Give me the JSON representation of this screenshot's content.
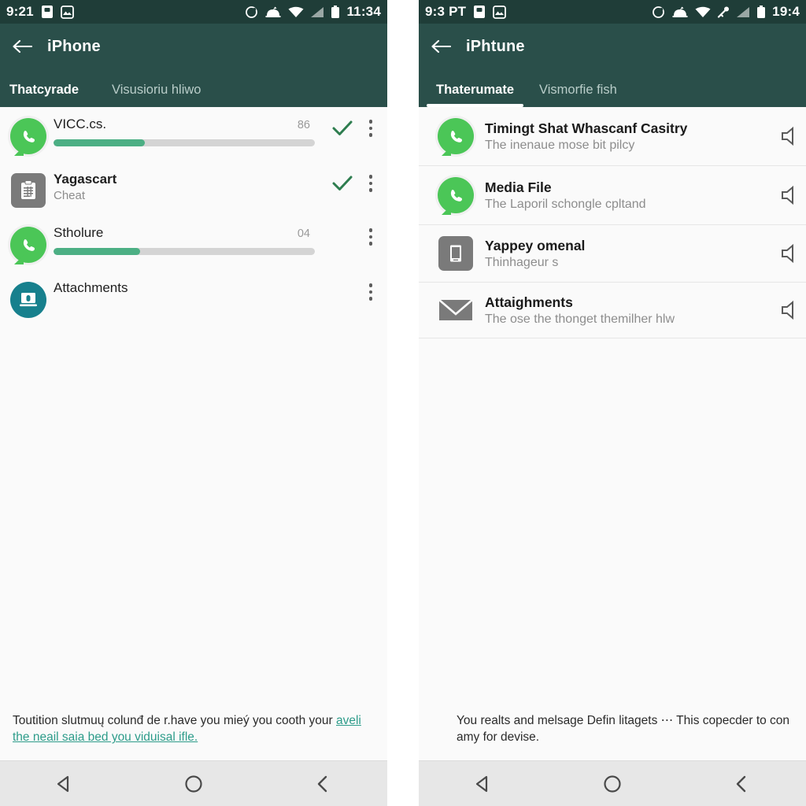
{
  "left": {
    "status_bar": {
      "clock_left": "9:21",
      "clock_right": "11:34",
      "icons_left": [
        "sim-card-icon",
        "photos-icon"
      ],
      "icons_right": [
        "sync-icon",
        "notification-icon",
        "wifi-icon",
        "signal-icon",
        "battery-icon"
      ]
    },
    "appbar": {
      "back": "back-arrow",
      "title": "iPhone"
    },
    "tabs": [
      {
        "label": "Thatcyrade",
        "active": true
      },
      {
        "label": "Visusioriu hliwo",
        "active": false
      }
    ],
    "rows": [
      {
        "icon": "whatsapp-icon",
        "title": "VICC.cs.",
        "subtitle": "",
        "value": "86",
        "progress": 35,
        "check": true,
        "menu": true,
        "bold": false
      },
      {
        "icon": "clipboard-icon",
        "title": "Yagascart",
        "subtitle": "Cheat",
        "value": "",
        "progress": -1,
        "check": true,
        "menu": true,
        "bold": true
      },
      {
        "icon": "whatsapp-icon",
        "title": "Stholure",
        "subtitle": "",
        "value": "04",
        "progress": 33,
        "check": false,
        "menu": true,
        "bold": false
      },
      {
        "icon": "laptop-lock-icon",
        "title": "Attachments",
        "subtitle": "",
        "value": "",
        "progress": -1,
        "check": false,
        "menu": true,
        "bold": false
      }
    ],
    "footnote": {
      "text": "Toutition slutmuų colunđ de r.have you mieý you cooth your ",
      "link": "aveli the neail saia bed you viduisal ifle."
    },
    "navbar": [
      "back-triangle-icon",
      "home-circle-icon",
      "recents-chevron-icon"
    ]
  },
  "right": {
    "status_bar": {
      "clock_left": "9:3 PT",
      "clock_right": "19:4",
      "icons_left": [
        "sim-card-icon",
        "photos-icon"
      ],
      "icons_right": [
        "sync-icon",
        "notification-icon",
        "wifi-icon",
        "key-icon",
        "signal-icon",
        "battery-icon"
      ]
    },
    "appbar": {
      "back": "back-arrow",
      "title": "iPhtune"
    },
    "tabs": [
      {
        "label": "Thaterumate",
        "active": true
      },
      {
        "label": "Vismorfie fish",
        "active": false
      }
    ],
    "rows": [
      {
        "icon": "whatsapp-icon",
        "title": "Timingt Shat Whascanf Casitry",
        "subtitle": "The inenaue mose bit pilcy",
        "trailing": "speaker-icon"
      },
      {
        "icon": "whatsapp-icon",
        "title": "Media File",
        "subtitle": "The Laporil schongle cpltand",
        "trailing": "speaker-icon"
      },
      {
        "icon": "phone-device-icon",
        "title": "Yappey omenal",
        "subtitle": "Thinhageur s",
        "trailing": "speaker-icon"
      },
      {
        "icon": "envelope-icon",
        "title": "Attaighments",
        "subtitle": "The ose the thonget themilher hlw",
        "trailing": "speaker-icon"
      }
    ],
    "footnote": {
      "text": "You realts and melsage Defin litagets ⋯ This copecder to con amy for devise.",
      "link": ""
    },
    "navbar": [
      "back-triangle-icon",
      "home-circle-icon",
      "recents-chevron-icon"
    ]
  },
  "colors": {
    "appbar": "#2a4f4a",
    "statusbar": "#1f3d38",
    "progress_fill": "#4caf84",
    "progress_track": "#d4d4d4",
    "check": "#2e7d4f",
    "link": "#2d9c8a",
    "whatsapp_green": "#4bc657",
    "teal_circle": "#17808d",
    "page_bg": "#fafafa",
    "navbar": "#e7e7e7"
  }
}
